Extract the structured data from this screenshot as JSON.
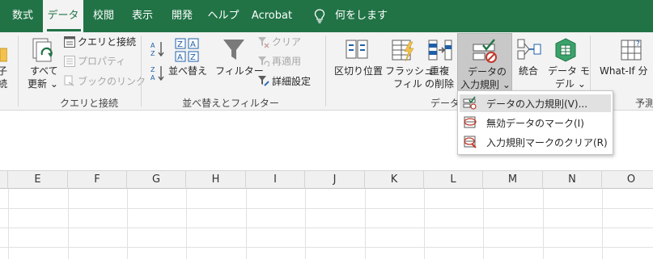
{
  "tabs": [
    {
      "label": "数式"
    },
    {
      "label": "データ"
    },
    {
      "label": "校閲"
    },
    {
      "label": "表示"
    },
    {
      "label": "開発"
    },
    {
      "label": "ヘルプ"
    },
    {
      "label": "Acrobat"
    }
  ],
  "tell_me": "何をしますか",
  "ribbon": {
    "partial_left": [
      "子",
      "続"
    ],
    "queries": {
      "refresh_all": [
        "すべて",
        "更新 ⌄"
      ],
      "queries_connections": "クエリと接続",
      "properties": "プロパティ",
      "edit_links": "ブックのリンク",
      "group_label": "クエリと接続"
    },
    "sort_filter": {
      "sort": "並べ替え",
      "filter": "フィルター",
      "clear": "クリア",
      "reapply": "再適用",
      "advanced": "詳細設定",
      "group_label": "並べ替えとフィルター"
    },
    "data_tools": {
      "text_to_columns": "区切り位置",
      "flash_fill": [
        "フラッシュ",
        "フィル"
      ],
      "remove_duplicates": [
        "重複",
        "の削除"
      ],
      "data_validation": [
        "データの",
        "入力規則 ⌄"
      ],
      "consolidate": "統合",
      "data_model": [
        "データ モ",
        "デル ⌄"
      ],
      "group_label": "データ"
    },
    "forecast": {
      "what_if": [
        "What-If 分"
      ],
      "group_label": "予測"
    }
  },
  "columns": [
    "E",
    "F",
    "G",
    "H",
    "I",
    "J",
    "K",
    "L",
    "M",
    "N",
    "O"
  ],
  "dropdown": {
    "items": [
      {
        "label": "データの入力規則(V)...",
        "highlighted": true
      },
      {
        "label": "無効データのマーク(I)",
        "highlighted": false
      },
      {
        "label": "入力規則マークのクリア(R)",
        "highlighted": false
      }
    ]
  },
  "colors": {
    "brand_green": "#217346",
    "ribbon_bg": "#f3f3f3",
    "header_bg": "#f0f0f0"
  }
}
